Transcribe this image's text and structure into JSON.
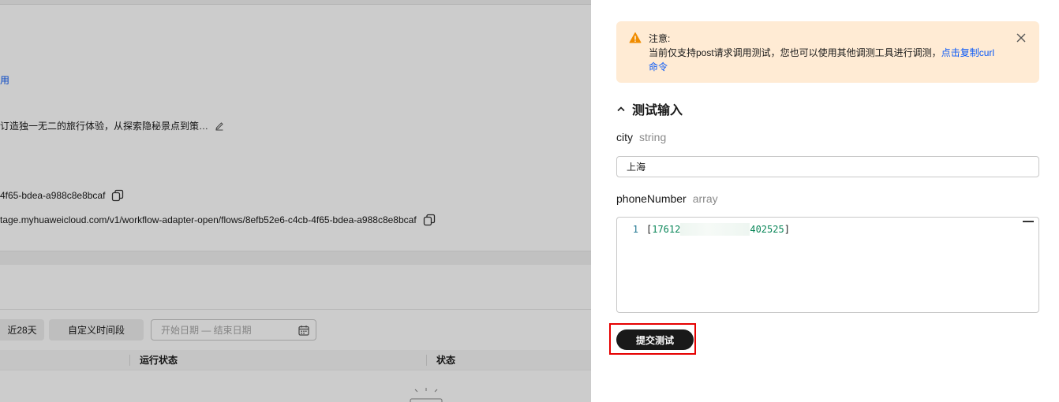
{
  "background": {
    "link_fragment": "用",
    "description": "订造独一无二的旅行体验，从探索隐秘景点到策…",
    "flow_id_fragment": "4f65-bdea-a988c8e8bcaf",
    "url_fragment": "tage.myhuaweicloud.com/v1/workflow-adapter-open/flows/8efb52e6-c4cb-4f65-bdea-a988c8e8bcaf",
    "filters": {
      "recent_label": "近28天",
      "custom_label": "自定义时间段",
      "date_placeholder": "开始日期 — 结束日期"
    },
    "table_headers": [
      "运行状态",
      "状态"
    ]
  },
  "drawer": {
    "notice": {
      "title": "注意:",
      "body": "当前仅支持post请求调用测试，您也可以使用其他调测工具进行调测，",
      "link": "点击复制curl命令"
    },
    "section_title": "测试输入",
    "fields": {
      "city": {
        "name": "city",
        "type": "string",
        "value": "上海"
      },
      "phone": {
        "name": "phoneNumber",
        "type": "array",
        "line_number": "1",
        "code_open": "[",
        "code_prefix": "17612",
        "code_suffix": "402525",
        "code_close": "]"
      }
    },
    "submit_label": "提交测试"
  },
  "colors": {
    "accent": "#0a59f7",
    "notice_bg": "#ffebd4",
    "warning": "#f08c00",
    "button": "#191919",
    "highlight": "#e60000"
  }
}
